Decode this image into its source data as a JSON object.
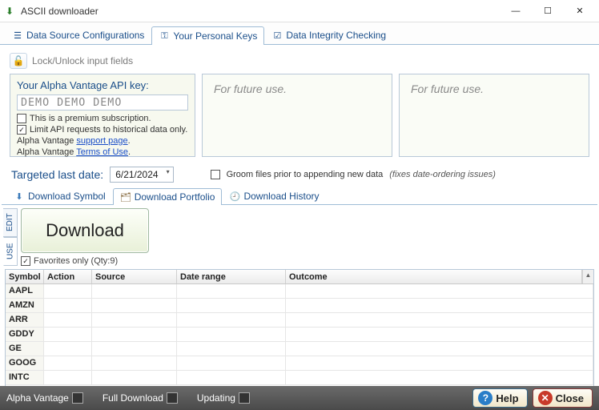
{
  "window": {
    "title": "ASCII downloader"
  },
  "main_tabs": [
    {
      "label": "Data Source Configurations",
      "icon": "list-icon"
    },
    {
      "label": "Your Personal Keys",
      "icon": "key-icon"
    },
    {
      "label": "Data Integrity Checking",
      "icon": "check-icon"
    }
  ],
  "main_tab_active": 1,
  "lock": {
    "label": "Lock/Unlock input fields"
  },
  "api_panel": {
    "title": "Your Alpha Vantage API key:",
    "value_masked": "DEMO DEMO DEMO",
    "premium_label": "This is a premium subscription.",
    "premium_checked": false,
    "limit_label": "Limit API requests to historical data only.",
    "limit_checked": true,
    "support_prefix": "Alpha Vantage ",
    "support_link": "support page",
    "terms_prefix": "Alpha Vantage ",
    "terms_link": "Terms of Use"
  },
  "future_panel_text": "For future use.",
  "target": {
    "label": "Targeted last date:",
    "value": "6/21/2024",
    "groom_checked": false,
    "groom_label": "Groom files prior to appending new data",
    "groom_hint": "(fixes date-ordering issues)"
  },
  "sub_tabs": [
    {
      "label": "Download Symbol"
    },
    {
      "label": "Download Portfolio"
    },
    {
      "label": "Download History"
    }
  ],
  "sub_tab_active": 1,
  "vert_tabs": {
    "edit": "EDIT",
    "use": "USE",
    "active": "use"
  },
  "download_button": "Download",
  "favorites": {
    "checked": true,
    "label": "Favorites only (Qty:9)"
  },
  "table": {
    "headers": {
      "symbol": "Symbol",
      "action": "Action",
      "source": "Source",
      "range": "Date range",
      "outcome": "Outcome"
    },
    "rows": [
      {
        "symbol": "AAPL"
      },
      {
        "symbol": "AMZN"
      },
      {
        "symbol": "ARR"
      },
      {
        "symbol": "GDDY"
      },
      {
        "symbol": "GE"
      },
      {
        "symbol": "GOOG"
      },
      {
        "symbol": "INTC"
      }
    ]
  },
  "status": {
    "alpha": "Alpha Vantage",
    "full": "Full Download",
    "updating": "Updating",
    "help": "Help",
    "close": "Close"
  }
}
